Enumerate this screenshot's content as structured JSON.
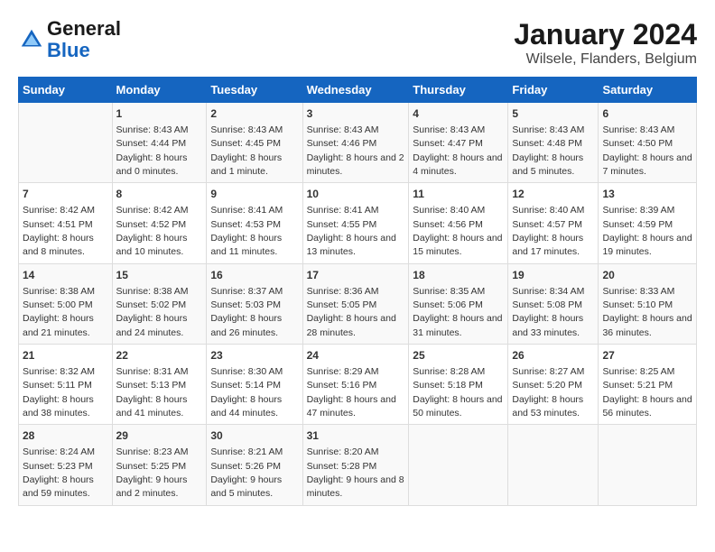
{
  "header": {
    "logo_general": "General",
    "logo_blue": "Blue",
    "title": "January 2024",
    "subtitle": "Wilsele, Flanders, Belgium"
  },
  "weekdays": [
    "Sunday",
    "Monday",
    "Tuesday",
    "Wednesday",
    "Thursday",
    "Friday",
    "Saturday"
  ],
  "weeks": [
    [
      {
        "day": "",
        "sunrise": "",
        "sunset": "",
        "daylight": ""
      },
      {
        "day": "1",
        "sunrise": "Sunrise: 8:43 AM",
        "sunset": "Sunset: 4:44 PM",
        "daylight": "Daylight: 8 hours and 0 minutes."
      },
      {
        "day": "2",
        "sunrise": "Sunrise: 8:43 AM",
        "sunset": "Sunset: 4:45 PM",
        "daylight": "Daylight: 8 hours and 1 minute."
      },
      {
        "day": "3",
        "sunrise": "Sunrise: 8:43 AM",
        "sunset": "Sunset: 4:46 PM",
        "daylight": "Daylight: 8 hours and 2 minutes."
      },
      {
        "day": "4",
        "sunrise": "Sunrise: 8:43 AM",
        "sunset": "Sunset: 4:47 PM",
        "daylight": "Daylight: 8 hours and 4 minutes."
      },
      {
        "day": "5",
        "sunrise": "Sunrise: 8:43 AM",
        "sunset": "Sunset: 4:48 PM",
        "daylight": "Daylight: 8 hours and 5 minutes."
      },
      {
        "day": "6",
        "sunrise": "Sunrise: 8:43 AM",
        "sunset": "Sunset: 4:50 PM",
        "daylight": "Daylight: 8 hours and 7 minutes."
      }
    ],
    [
      {
        "day": "7",
        "sunrise": "Sunrise: 8:42 AM",
        "sunset": "Sunset: 4:51 PM",
        "daylight": "Daylight: 8 hours and 8 minutes."
      },
      {
        "day": "8",
        "sunrise": "Sunrise: 8:42 AM",
        "sunset": "Sunset: 4:52 PM",
        "daylight": "Daylight: 8 hours and 10 minutes."
      },
      {
        "day": "9",
        "sunrise": "Sunrise: 8:41 AM",
        "sunset": "Sunset: 4:53 PM",
        "daylight": "Daylight: 8 hours and 11 minutes."
      },
      {
        "day": "10",
        "sunrise": "Sunrise: 8:41 AM",
        "sunset": "Sunset: 4:55 PM",
        "daylight": "Daylight: 8 hours and 13 minutes."
      },
      {
        "day": "11",
        "sunrise": "Sunrise: 8:40 AM",
        "sunset": "Sunset: 4:56 PM",
        "daylight": "Daylight: 8 hours and 15 minutes."
      },
      {
        "day": "12",
        "sunrise": "Sunrise: 8:40 AM",
        "sunset": "Sunset: 4:57 PM",
        "daylight": "Daylight: 8 hours and 17 minutes."
      },
      {
        "day": "13",
        "sunrise": "Sunrise: 8:39 AM",
        "sunset": "Sunset: 4:59 PM",
        "daylight": "Daylight: 8 hours and 19 minutes."
      }
    ],
    [
      {
        "day": "14",
        "sunrise": "Sunrise: 8:38 AM",
        "sunset": "Sunset: 5:00 PM",
        "daylight": "Daylight: 8 hours and 21 minutes."
      },
      {
        "day": "15",
        "sunrise": "Sunrise: 8:38 AM",
        "sunset": "Sunset: 5:02 PM",
        "daylight": "Daylight: 8 hours and 24 minutes."
      },
      {
        "day": "16",
        "sunrise": "Sunrise: 8:37 AM",
        "sunset": "Sunset: 5:03 PM",
        "daylight": "Daylight: 8 hours and 26 minutes."
      },
      {
        "day": "17",
        "sunrise": "Sunrise: 8:36 AM",
        "sunset": "Sunset: 5:05 PM",
        "daylight": "Daylight: 8 hours and 28 minutes."
      },
      {
        "day": "18",
        "sunrise": "Sunrise: 8:35 AM",
        "sunset": "Sunset: 5:06 PM",
        "daylight": "Daylight: 8 hours and 31 minutes."
      },
      {
        "day": "19",
        "sunrise": "Sunrise: 8:34 AM",
        "sunset": "Sunset: 5:08 PM",
        "daylight": "Daylight: 8 hours and 33 minutes."
      },
      {
        "day": "20",
        "sunrise": "Sunrise: 8:33 AM",
        "sunset": "Sunset: 5:10 PM",
        "daylight": "Daylight: 8 hours and 36 minutes."
      }
    ],
    [
      {
        "day": "21",
        "sunrise": "Sunrise: 8:32 AM",
        "sunset": "Sunset: 5:11 PM",
        "daylight": "Daylight: 8 hours and 38 minutes."
      },
      {
        "day": "22",
        "sunrise": "Sunrise: 8:31 AM",
        "sunset": "Sunset: 5:13 PM",
        "daylight": "Daylight: 8 hours and 41 minutes."
      },
      {
        "day": "23",
        "sunrise": "Sunrise: 8:30 AM",
        "sunset": "Sunset: 5:14 PM",
        "daylight": "Daylight: 8 hours and 44 minutes."
      },
      {
        "day": "24",
        "sunrise": "Sunrise: 8:29 AM",
        "sunset": "Sunset: 5:16 PM",
        "daylight": "Daylight: 8 hours and 47 minutes."
      },
      {
        "day": "25",
        "sunrise": "Sunrise: 8:28 AM",
        "sunset": "Sunset: 5:18 PM",
        "daylight": "Daylight: 8 hours and 50 minutes."
      },
      {
        "day": "26",
        "sunrise": "Sunrise: 8:27 AM",
        "sunset": "Sunset: 5:20 PM",
        "daylight": "Daylight: 8 hours and 53 minutes."
      },
      {
        "day": "27",
        "sunrise": "Sunrise: 8:25 AM",
        "sunset": "Sunset: 5:21 PM",
        "daylight": "Daylight: 8 hours and 56 minutes."
      }
    ],
    [
      {
        "day": "28",
        "sunrise": "Sunrise: 8:24 AM",
        "sunset": "Sunset: 5:23 PM",
        "daylight": "Daylight: 8 hours and 59 minutes."
      },
      {
        "day": "29",
        "sunrise": "Sunrise: 8:23 AM",
        "sunset": "Sunset: 5:25 PM",
        "daylight": "Daylight: 9 hours and 2 minutes."
      },
      {
        "day": "30",
        "sunrise": "Sunrise: 8:21 AM",
        "sunset": "Sunset: 5:26 PM",
        "daylight": "Daylight: 9 hours and 5 minutes."
      },
      {
        "day": "31",
        "sunrise": "Sunrise: 8:20 AM",
        "sunset": "Sunset: 5:28 PM",
        "daylight": "Daylight: 9 hours and 8 minutes."
      },
      {
        "day": "",
        "sunrise": "",
        "sunset": "",
        "daylight": ""
      },
      {
        "day": "",
        "sunrise": "",
        "sunset": "",
        "daylight": ""
      },
      {
        "day": "",
        "sunrise": "",
        "sunset": "",
        "daylight": ""
      }
    ]
  ]
}
